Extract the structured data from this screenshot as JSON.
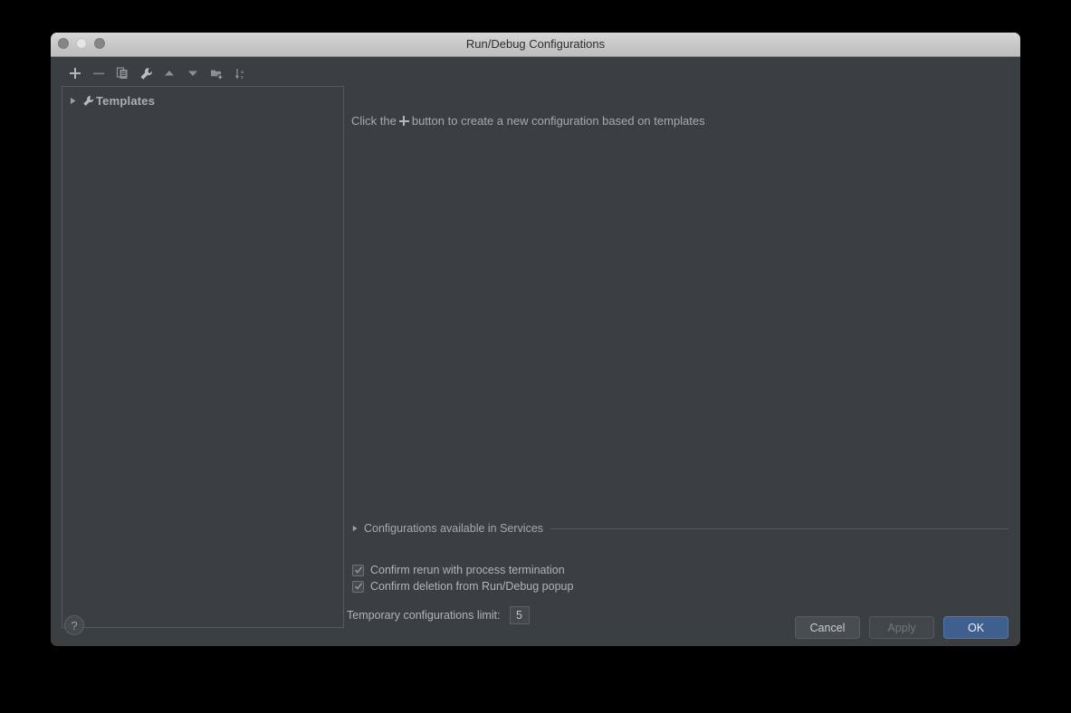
{
  "window": {
    "title": "Run/Debug Configurations",
    "traffic_lights": [
      "close-button",
      "minimize-button",
      "zoom-button"
    ]
  },
  "toolbar": {
    "buttons": [
      {
        "name": "add-configuration-button",
        "icon": "plus-icon",
        "label": "Add New Configuration"
      },
      {
        "name": "remove-configuration-button",
        "icon": "minus-icon",
        "label": "Remove Configuration"
      },
      {
        "name": "copy-configuration-button",
        "icon": "copy-icon",
        "label": "Copy Configuration"
      },
      {
        "name": "edit-templates-button",
        "icon": "wrench-icon",
        "label": "Edit Templates"
      },
      {
        "name": "move-up-button",
        "icon": "arrow-up-icon",
        "label": "Move Up"
      },
      {
        "name": "move-down-button",
        "icon": "arrow-down-icon",
        "label": "Move Down"
      },
      {
        "name": "new-folder-button",
        "icon": "folder-add-icon",
        "label": "Create New Folder"
      },
      {
        "name": "sort-configurations-button",
        "icon": "sort-alpha-icon",
        "label": "Sort Configurations"
      }
    ]
  },
  "tree": {
    "items": [
      {
        "label": "Templates",
        "icon": "wrench-icon",
        "expanded": false,
        "arrow": "triangle-right-icon"
      }
    ]
  },
  "main": {
    "hint_prefix": "Click the",
    "hint_suffix": "button to create a new configuration based on templates",
    "services": {
      "label": "Configurations available in Services",
      "expanded": false,
      "arrow": "triangle-right-icon"
    },
    "checkboxes": [
      {
        "label": "Confirm rerun with process termination",
        "checked": true
      },
      {
        "label": "Confirm deletion from Run/Debug popup",
        "checked": true
      }
    ],
    "temporary_limit": {
      "label": "Temporary configurations limit:",
      "value": "5"
    }
  },
  "footer": {
    "help_label": "?",
    "buttons": [
      {
        "label": "Cancel",
        "name": "cancel-button",
        "state": "enabled"
      },
      {
        "label": "Apply",
        "name": "apply-button",
        "state": "disabled"
      },
      {
        "label": "OK",
        "name": "ok-button",
        "state": "primary"
      }
    ]
  },
  "colors": {
    "dialog_bg": "#3c3f41",
    "titlebar_bg": "#c8c8c8",
    "text": "#a6aaad",
    "accent": "#3f608f",
    "border": "#555a5e"
  }
}
